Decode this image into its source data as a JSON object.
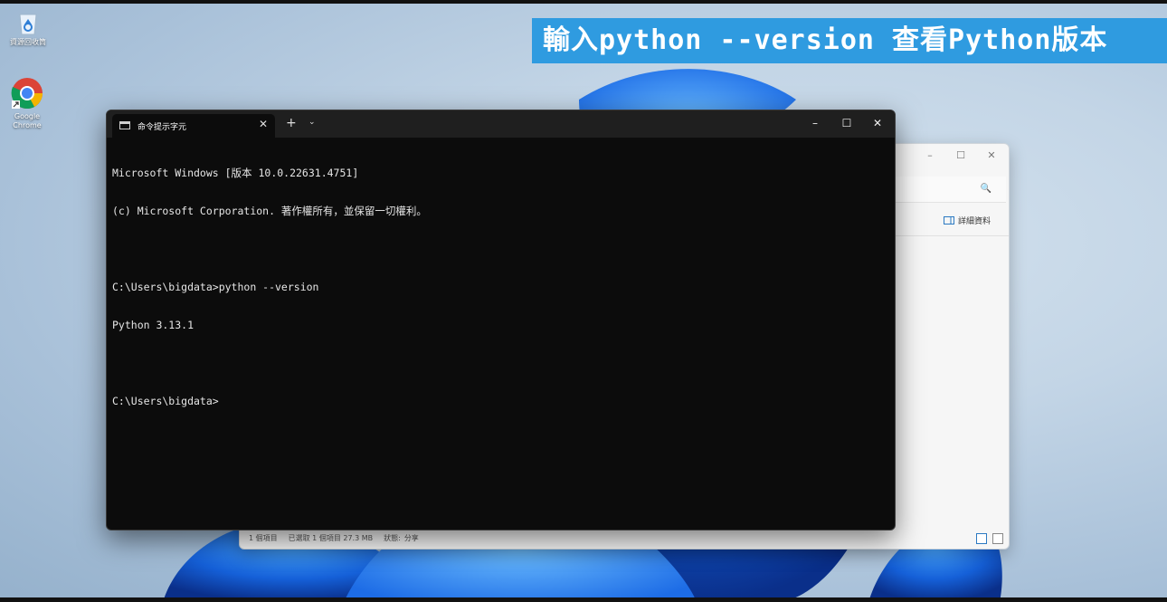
{
  "desktop": {
    "icons": [
      {
        "label": "資源回收筒",
        "icon": "recycle-bin-icon"
      },
      {
        "label_lines": [
          "Google",
          "Chrome"
        ],
        "icon": "chrome-icon"
      }
    ]
  },
  "banner": {
    "text": "輸入python --version 查看Python版本"
  },
  "explorer": {
    "controls": [
      "–",
      "☐",
      "✕"
    ],
    "search_icon": "🔍",
    "details_label": "詳細資料",
    "status": [
      "1 個項目",
      "已選取 1 個項目 27.3 MB",
      "狀態:",
      "分享"
    ]
  },
  "terminal": {
    "tab_title": "命令提示字元",
    "tab_close": "✕",
    "new_tab": "+",
    "dropdown": "⌄",
    "controls": {
      "minimize": "–",
      "maximize": "☐",
      "close": "✕"
    },
    "lines": [
      "Microsoft Windows [版本 10.0.22631.4751]",
      "(c) Microsoft Corporation. 著作權所有，並保留一切權利。",
      "",
      "C:\\Users\\bigdata>python --version",
      "Python 3.13.1",
      "",
      "C:\\Users\\bigdata>"
    ]
  },
  "colors": {
    "banner_bg": "#2f9be0",
    "terminal_bg": "#0c0c0c",
    "tabbar_bg": "#1f1f1f"
  }
}
